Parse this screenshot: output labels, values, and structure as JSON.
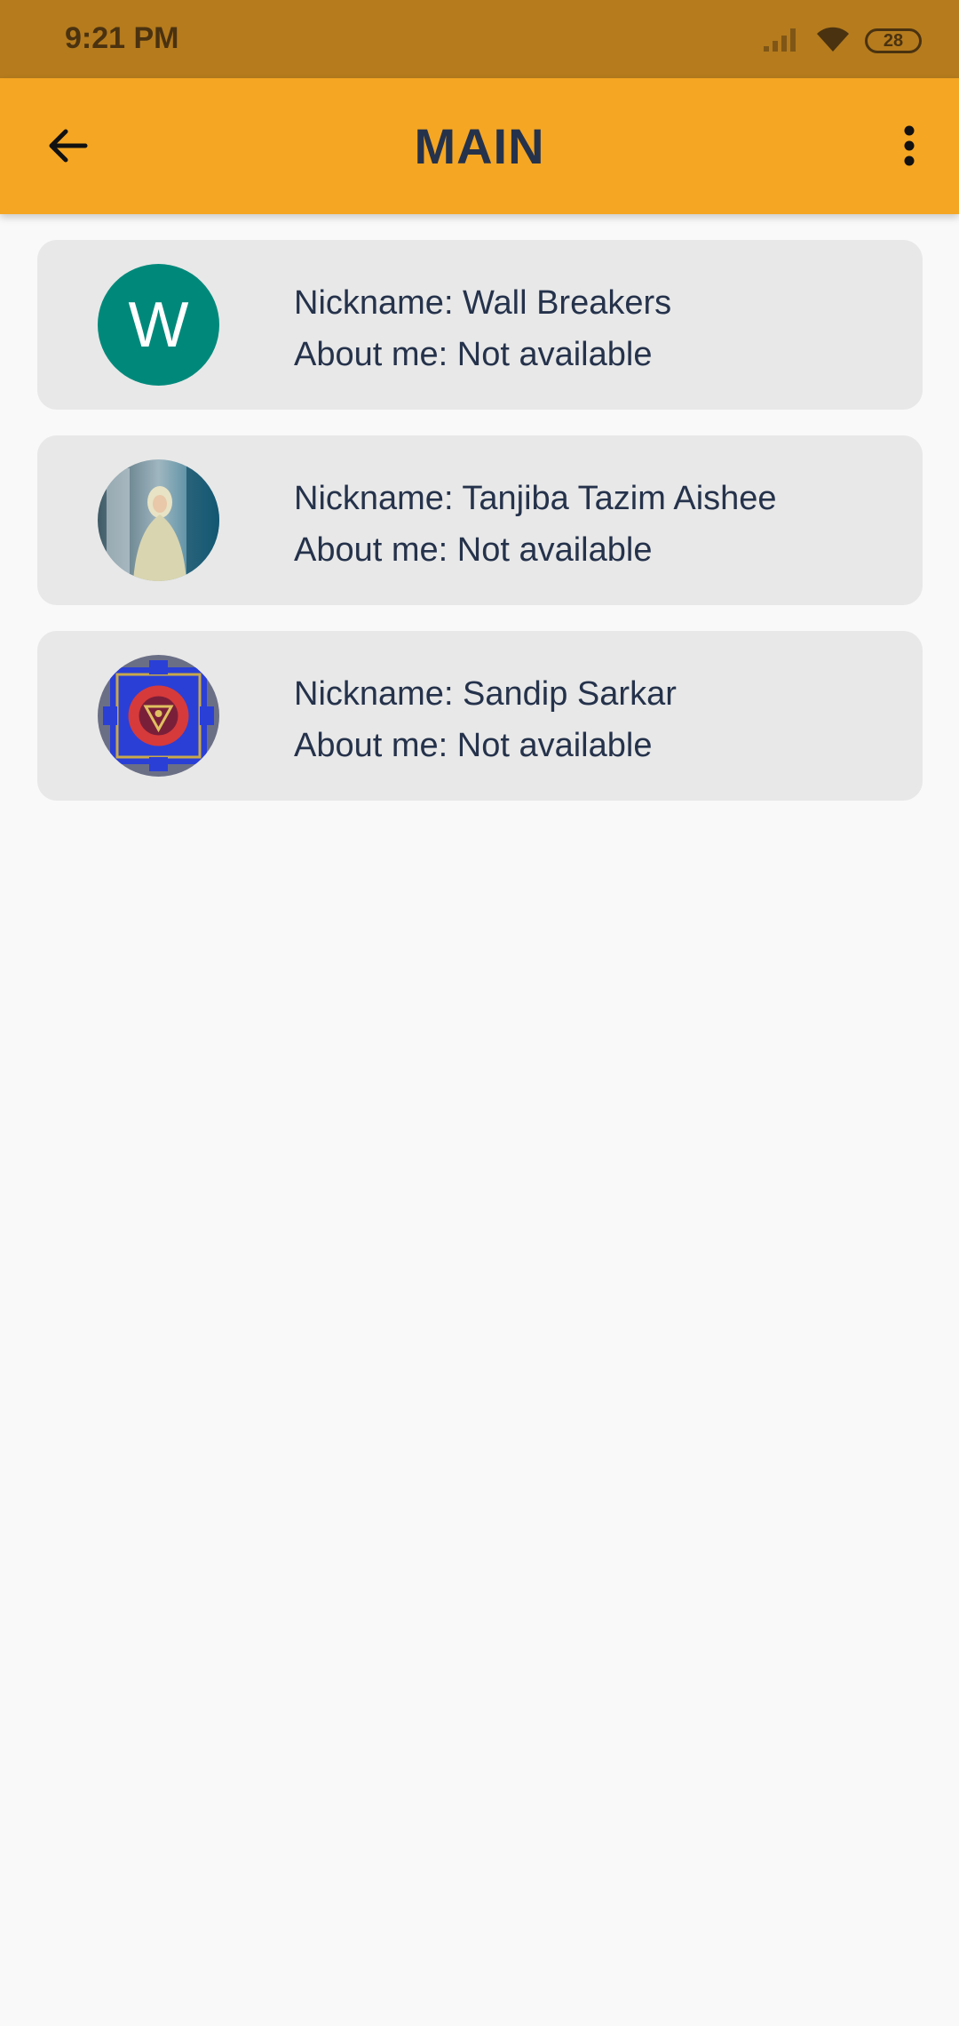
{
  "status_bar": {
    "time": "9:21 PM",
    "battery": "28"
  },
  "app_bar": {
    "title": "MAIN"
  },
  "contacts": [
    {
      "nickname": "Nickname: Wall Breakers",
      "about": "About me: Not available",
      "avatar_letter": "W"
    },
    {
      "nickname": "Nickname: Tanjiba Tazim Aishee",
      "about": "About me: Not available"
    },
    {
      "nickname": "Nickname: Sandip Sarkar",
      "about": "About me: Not available"
    }
  ],
  "colors": {
    "status_bar": "#b57b1d",
    "app_bar": "#f5a623",
    "title_text": "#25324b",
    "card_bg": "#e8e8e8",
    "avatar_letter_bg": "#00897b"
  }
}
